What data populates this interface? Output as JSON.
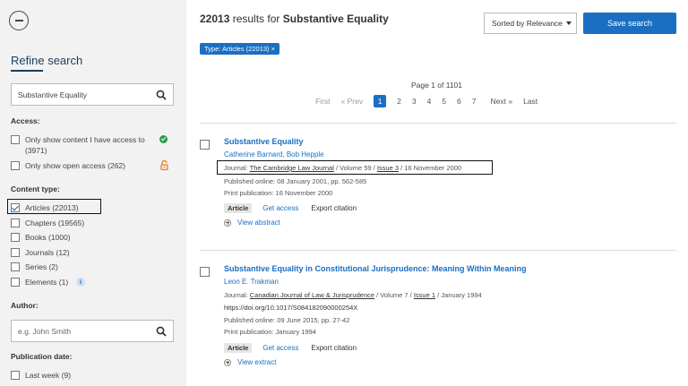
{
  "sidebar": {
    "refine_title": "Refine search",
    "search_value": "Substantive Equality",
    "access_label": "Access:",
    "access_items": [
      {
        "label_line1": "Only show content I have access to",
        "label_line2": "(3971)"
      },
      {
        "label": "Only show open access (262)"
      }
    ],
    "content_type_label": "Content type:",
    "content_types": [
      {
        "label": "Articles (22013)",
        "checked": true
      },
      {
        "label": "Chapters (19565)",
        "checked": false
      },
      {
        "label": "Books (1000)",
        "checked": false
      },
      {
        "label": "Journals (12)",
        "checked": false
      },
      {
        "label": "Series (2)",
        "checked": false
      },
      {
        "label": "Elements (1)",
        "checked": false
      }
    ],
    "author_label": "Author:",
    "author_placeholder": "e.g. John Smith",
    "pubdate_label": "Publication date:",
    "pubdate_items": [
      {
        "label": "Last week (9)"
      }
    ]
  },
  "header": {
    "count": "22013",
    "results_for": " results for ",
    "query": "Substantive Equality",
    "sort_label": "Sorted by Relevance",
    "save_label": "Save search",
    "filter_tag": "Type: Articles (22013) ×"
  },
  "pagination": {
    "page_of": "Page 1 of 1101",
    "first": "First",
    "prev": "« Prev",
    "pages": [
      "1",
      "2",
      "3",
      "4",
      "5",
      "6",
      "7"
    ],
    "next": "Next »",
    "last": "Last"
  },
  "results": [
    {
      "title": "Substantive Equality",
      "authors": "Catherine Barnard, Bob Hepple",
      "journal_prefix": "Journal: ",
      "journal": "The Cambridge Law Journal",
      "volume": " / Volume 59 / ",
      "issue": "Issue 3",
      "date": " / 16 November 2000",
      "published_online": "Published online: 08 January 2001, pp. 562-585",
      "print_publication": "Print publication: 16 November 2000",
      "badge": "Article",
      "get_access": "Get access",
      "export": "Export citation",
      "expand": "View abstract"
    },
    {
      "title": "Substantive Equality in Constitutional Jurisprudence: Meaning Within Meaning",
      "authors": "Leon E. Trakman",
      "journal_prefix": "Journal: ",
      "journal": "Canadian Journal of Law & Jurisprudence",
      "volume": " / Volume 7 / ",
      "issue": "Issue 1",
      "date": " / January 1994",
      "doi": "https://doi.org/10.1017/S084182090000254X",
      "published_online": "Published online: 09 June 2015, pp. 27-42",
      "print_publication": "Print publication: January 1994",
      "badge": "Article",
      "get_access": "Get access",
      "export": "Export citation",
      "expand": "View extract"
    }
  ],
  "colors": {
    "accent": "#1a6fc2",
    "sidebar_bg": "#f2f2f2",
    "open_access": "#e67e22",
    "access_check": "#2e9b4a"
  }
}
